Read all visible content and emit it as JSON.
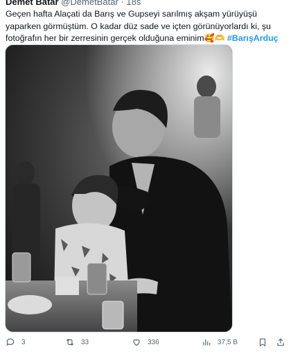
{
  "author": {
    "name": "Demet Batar",
    "handle": "@DemetBatar",
    "time": "18s"
  },
  "tweet": {
    "line1": "Geçen hafta Alaçati da Barış ve Gupseyi sarılmış akşam yürüyüşü yaparken görmüştüm. O kadar düz sade ve içten görünüyorlardı ki, şu fotoğrafın her bir zerresinin gerçek olduğuna eminim",
    "emoji": "🥰🫶",
    "hashtag": "#BarışArduç"
  },
  "media": {
    "description_icon": "photo-icon"
  },
  "actions": {
    "replies": "3",
    "retweets": "33",
    "likes": "336",
    "views": "37,5 B"
  },
  "icons": {
    "reply": "reply-icon",
    "retweet": "retweet-icon",
    "like": "heart-icon",
    "views": "views-icon",
    "bookmark": "bookmark-icon",
    "share": "share-icon"
  },
  "colors": {
    "hashtag": "#1d9bf0",
    "muted": "#536471"
  }
}
